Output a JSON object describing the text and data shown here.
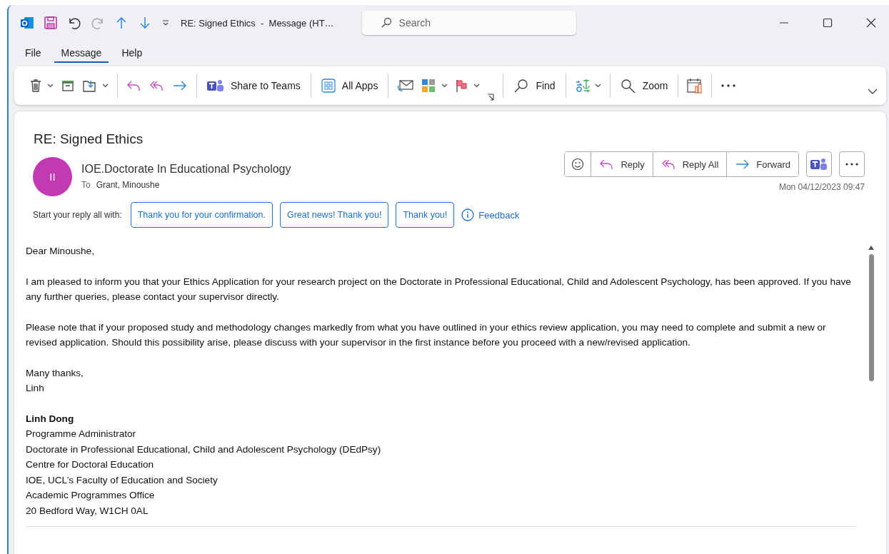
{
  "window": {
    "title": "RE: Signed Ethics  -  Message (HT…"
  },
  "search": {
    "placeholder": "Search"
  },
  "menu": [
    {
      "label": "File",
      "selected": false
    },
    {
      "label": "Message",
      "selected": true
    },
    {
      "label": "Help",
      "selected": false
    }
  ],
  "ribbon": {
    "labels": [
      "Share to Teams",
      "All Apps",
      "Find",
      "Zoom"
    ]
  },
  "message": {
    "subject": "RE: Signed Ethics",
    "avatar": "II",
    "sender": "IOE.Doctorate In Educational Psychology",
    "to_label": "To",
    "recipient": "Grant, Minoushe",
    "actions": [
      "Reply",
      "Reply All",
      "Forward"
    ],
    "date": "Mon 04/12/2023 09:47",
    "suggest_label": "Start your reply all with:",
    "suggestions": [
      "Thank you for your confirmation.",
      "Great news! Thank you!",
      "Thank you!"
    ],
    "feedback": "Feedback"
  },
  "body": {
    "paragraphs": [
      [
        "Dear Minoushe,"
      ],
      [
        "I am pleased to inform you that your Ethics Application for your research project on the Doctorate in Professional Educational, Child and Adolescent Psychology, has been approved. If you have any further queries, please contact your supervisor directly."
      ],
      [
        "Please note that if your proposed study and methodology changes markedly from what you have outlined in your ethics review application, you may need to complete and submit a new or revised application. Should this possibility arise, please discuss with your supervisor in the first instance before you proceed with a new/revised application."
      ],
      [
        "Many thanks,",
        "Linh"
      ]
    ],
    "signature": {
      "name": "Linh Dong",
      "lines": [
        "Programme Administrator",
        "Doctorate in Professional Educational, Child and Adolescent Psychology (DEdPsy)",
        "Centre for Doctoral Education",
        "IOE, UCL’s Faculty of Education and Society",
        "Academic Programmes Office",
        "20 Bedford Way, W1CH 0AL"
      ]
    }
  }
}
